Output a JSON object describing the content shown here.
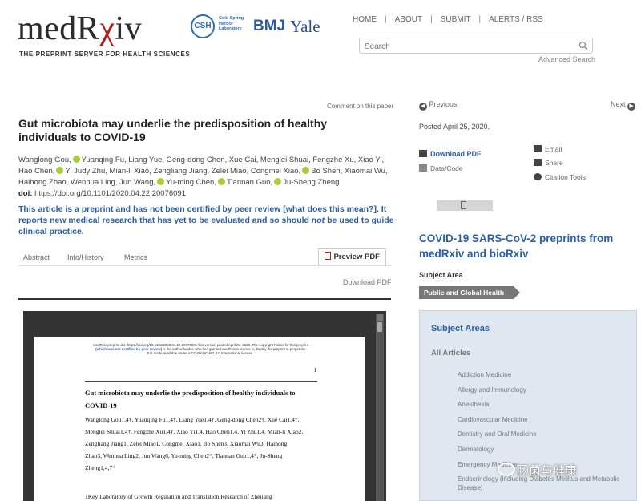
{
  "brand": {
    "logo_prefix": "medR",
    "logo_chi": "χ",
    "logo_suffix": "iv",
    "tagline": "THE PREPRINT SERVER FOR HEALTH SCIENCES",
    "csh": "CSH",
    "csh_text": "Cold Spring Harbor Laboratory",
    "bmj": "BMJ",
    "yale": "Yale"
  },
  "nav": {
    "home": "HOME",
    "about": "ABOUT",
    "submit": "SUBMIT",
    "alerts": "ALERTS / RSS",
    "sep": "|"
  },
  "search": {
    "placeholder": "Search",
    "advanced": "Advanced Search"
  },
  "article": {
    "comment": "Comment on this paper",
    "title": "Gut microbiota may underlie the predisposition of healthy individuals to COVID-19",
    "authors_1": "Wanglong Gou,",
    "authors_2": "Yuanqing Fu, Liang Yue, Geng-dong Chen, Xue Cai, Menglei Shuai, Fengzhe Xu, Xiao Yi, Hao Chen,",
    "authors_3": "Yi Judy Zhu, Mian-li Xiao, Zengliang Jiang, Zelei Miao, Congmei Xiao,",
    "authors_4": "Bo Shen, Xiaomai Wu, Haihong Zhao, Wenhua Ling, Jun Wang,",
    "authors_5": "Yu-ming Chen,",
    "authors_6": "Tiannan Guo,",
    "authors_7": "Ju-Sheng Zheng",
    "doi_label": "doi:",
    "doi": "https://doi.org/10.1101/2020.04.22.20076091",
    "notice_a": "This article is a preprint and has not been certified by peer review [what does this mean?]. It reports new medical research that has yet to be evaluated and so should ",
    "notice_not": "not",
    "notice_b": " be used to guide clinical practice."
  },
  "tabs": {
    "abstract": "Abstract",
    "info": "Info/History",
    "metrics": "Metrics",
    "preview": "Preview PDF"
  },
  "download_pdf_link": "Download PDF",
  "pdf_page": {
    "header_1": "medRxiv preprint doi: https://doi.org/10.1101/2020.04.22.20076091 this version posted April 25, 2020. The copyright holder for this preprint",
    "header_2": "(which was not certified by peer review)",
    "header_2b": " is the author/funder, who has granted medRxiv a license to display the preprint in perpetuity.",
    "header_3": "It is made available under a CC-BY-NC-ND 4.0 International license .",
    "page_num": "1",
    "title_1": "Gut microbiota may underlie the predisposition of healthy individuals to",
    "title_2": "COVID-19",
    "authors_1": "Wanglong Gou1,4†, Yuanqing Fu1,4†, Liang Yue1,4†, Geng-dong Chen2†, Xue Cai1,4†,",
    "authors_2": "Menglei Shuai1,4†, Fengzhe Xu1,4†, Xiao Yi1,4, Hao Chen1,4, Yi Zhu1,4, Mian-li Xiao2,",
    "authors_3": "Zengliang Jiang1, Zelei Miao1, Congmei Xiao1, Bo Shen3, Xiaomai Wu3, Haihong",
    "authors_4": "Zhao3, Wenhua Ling2, Jun Wang6, Yu-ming Chen2*, Tiannan Guo1,4*, Ju-Sheng",
    "authors_5": "Zheng1,4,7*",
    "affil": "1Key Laboratory of Growth Regulation and Translation Research of Zhejiang"
  },
  "sidebar": {
    "previous": "Previous",
    "next": "Next",
    "posted": "Posted April 25, 2020.",
    "download_pdf": "Download PDF",
    "data_code": "Data/Code",
    "email": "Email",
    "share": "Share",
    "citation": "Citation Tools",
    "covid_title": "COVID-19 SARS-CoV-2 preprints from medRxiv and bioRxiv",
    "subject_area_label": "Subject Area",
    "subject_area": "Public and Global Health",
    "subject_areas_heading": "Subject Areas",
    "all_articles": "All Articles",
    "areas": [
      "Addiction Medicine",
      "Allergy and Immunology",
      "Anesthesia",
      "Cardiovascular Medicine",
      "Dentistry and Oral Medicine",
      "Dermatology",
      "Emergency Medicine",
      "Endocrinology (including Diabetes Mellitus and Metabolic Disease)"
    ]
  },
  "watermark": "肠菌与健康"
}
